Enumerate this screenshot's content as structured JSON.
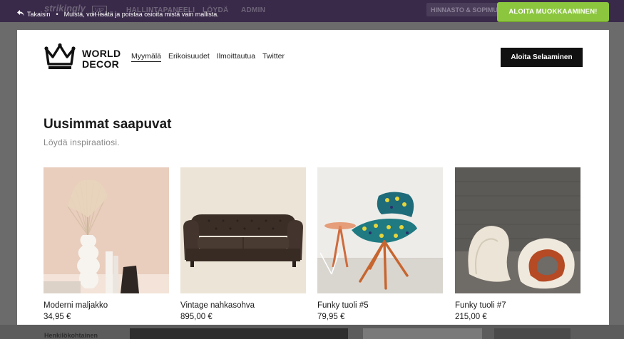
{
  "editor": {
    "logo": "strikingly",
    "vip": "VIP",
    "nav": [
      "HALLINTAPANEELI",
      "LÖYDÄ",
      "ADMIN"
    ],
    "pricing": "HINNASTO & SOPIMUKSET",
    "back_label": "Takaisin",
    "hint": "Muista, voit lisätä ja poistaa osioita mistä vain mallista.",
    "cta_label": "ALOITA MUOKKAAMINEN!",
    "under_label": "Henkilökohtainen"
  },
  "site": {
    "logo_line1": "WORLD",
    "logo_line2": "DECOR",
    "nav": [
      {
        "label": "Myymälä",
        "active": true
      },
      {
        "label": "Erikoisuudet"
      },
      {
        "label": "Ilmoittautua"
      },
      {
        "label": "Twitter"
      }
    ],
    "start_button": "Aloita Selaaminen",
    "section_title": "Uusimmat saapuvat",
    "section_subtitle": "Löydä inspiraatiosi.",
    "products": [
      {
        "name": "Moderni maljakko",
        "price": "34,95 €"
      },
      {
        "name": "Vintage nahkasohva",
        "price": "895,00 €"
      },
      {
        "name": "Funky tuoli #5",
        "price": "79,95 €"
      },
      {
        "name": "Funky tuoli #7",
        "price": "215,00 €"
      }
    ]
  },
  "colors": {
    "editor_bar": "#3a2a4a",
    "cta_green": "#8cc63f",
    "button_black": "#111111"
  }
}
